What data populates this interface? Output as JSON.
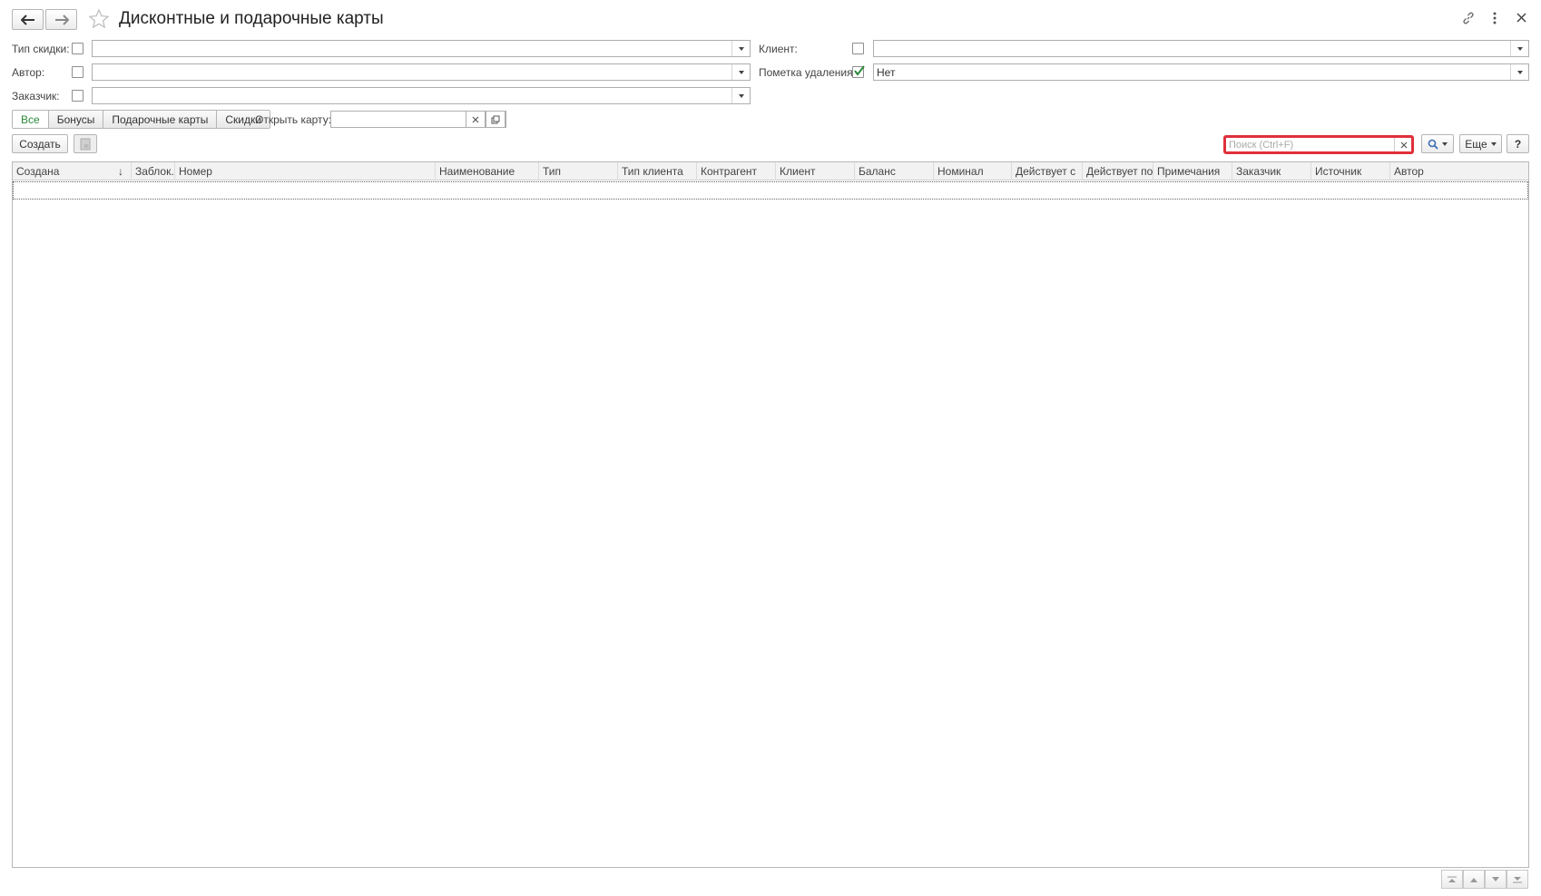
{
  "window": {
    "title": "Дисконтные и подарочные карты"
  },
  "filters": {
    "discount_type_label": "Тип скидки:",
    "author_label": "Автор:",
    "customer_label": "Заказчик:",
    "client_label": "Клиент:",
    "deletion_mark_label": "Пометка удаления:",
    "deletion_mark_value": "Нет"
  },
  "tabs": [
    {
      "label": "Все",
      "active": true
    },
    {
      "label": "Бонусы"
    },
    {
      "label": "Подарочные карты"
    },
    {
      "label": "Скидки"
    }
  ],
  "open_card": {
    "label": "Открыть карту:",
    "value": ""
  },
  "toolbar": {
    "create_label": "Создать",
    "more_label": "Еще",
    "help_label": "?",
    "search_placeholder": "Поиск (Ctrl+F)"
  },
  "table": {
    "columns": [
      "Создана",
      "Заблок.",
      "Номер",
      "Наименование",
      "Тип",
      "Тип клиента",
      "Контрагент",
      "Клиент",
      "Баланс",
      "Номинал",
      "Действует с",
      "Действует по",
      "Примечания",
      "Заказчик",
      "Источник",
      "Автор"
    ],
    "sort_indicator": "↓",
    "rows": []
  },
  "colors": {
    "accent_green": "#2a8a3a",
    "search_highlight": "#e0303a"
  }
}
